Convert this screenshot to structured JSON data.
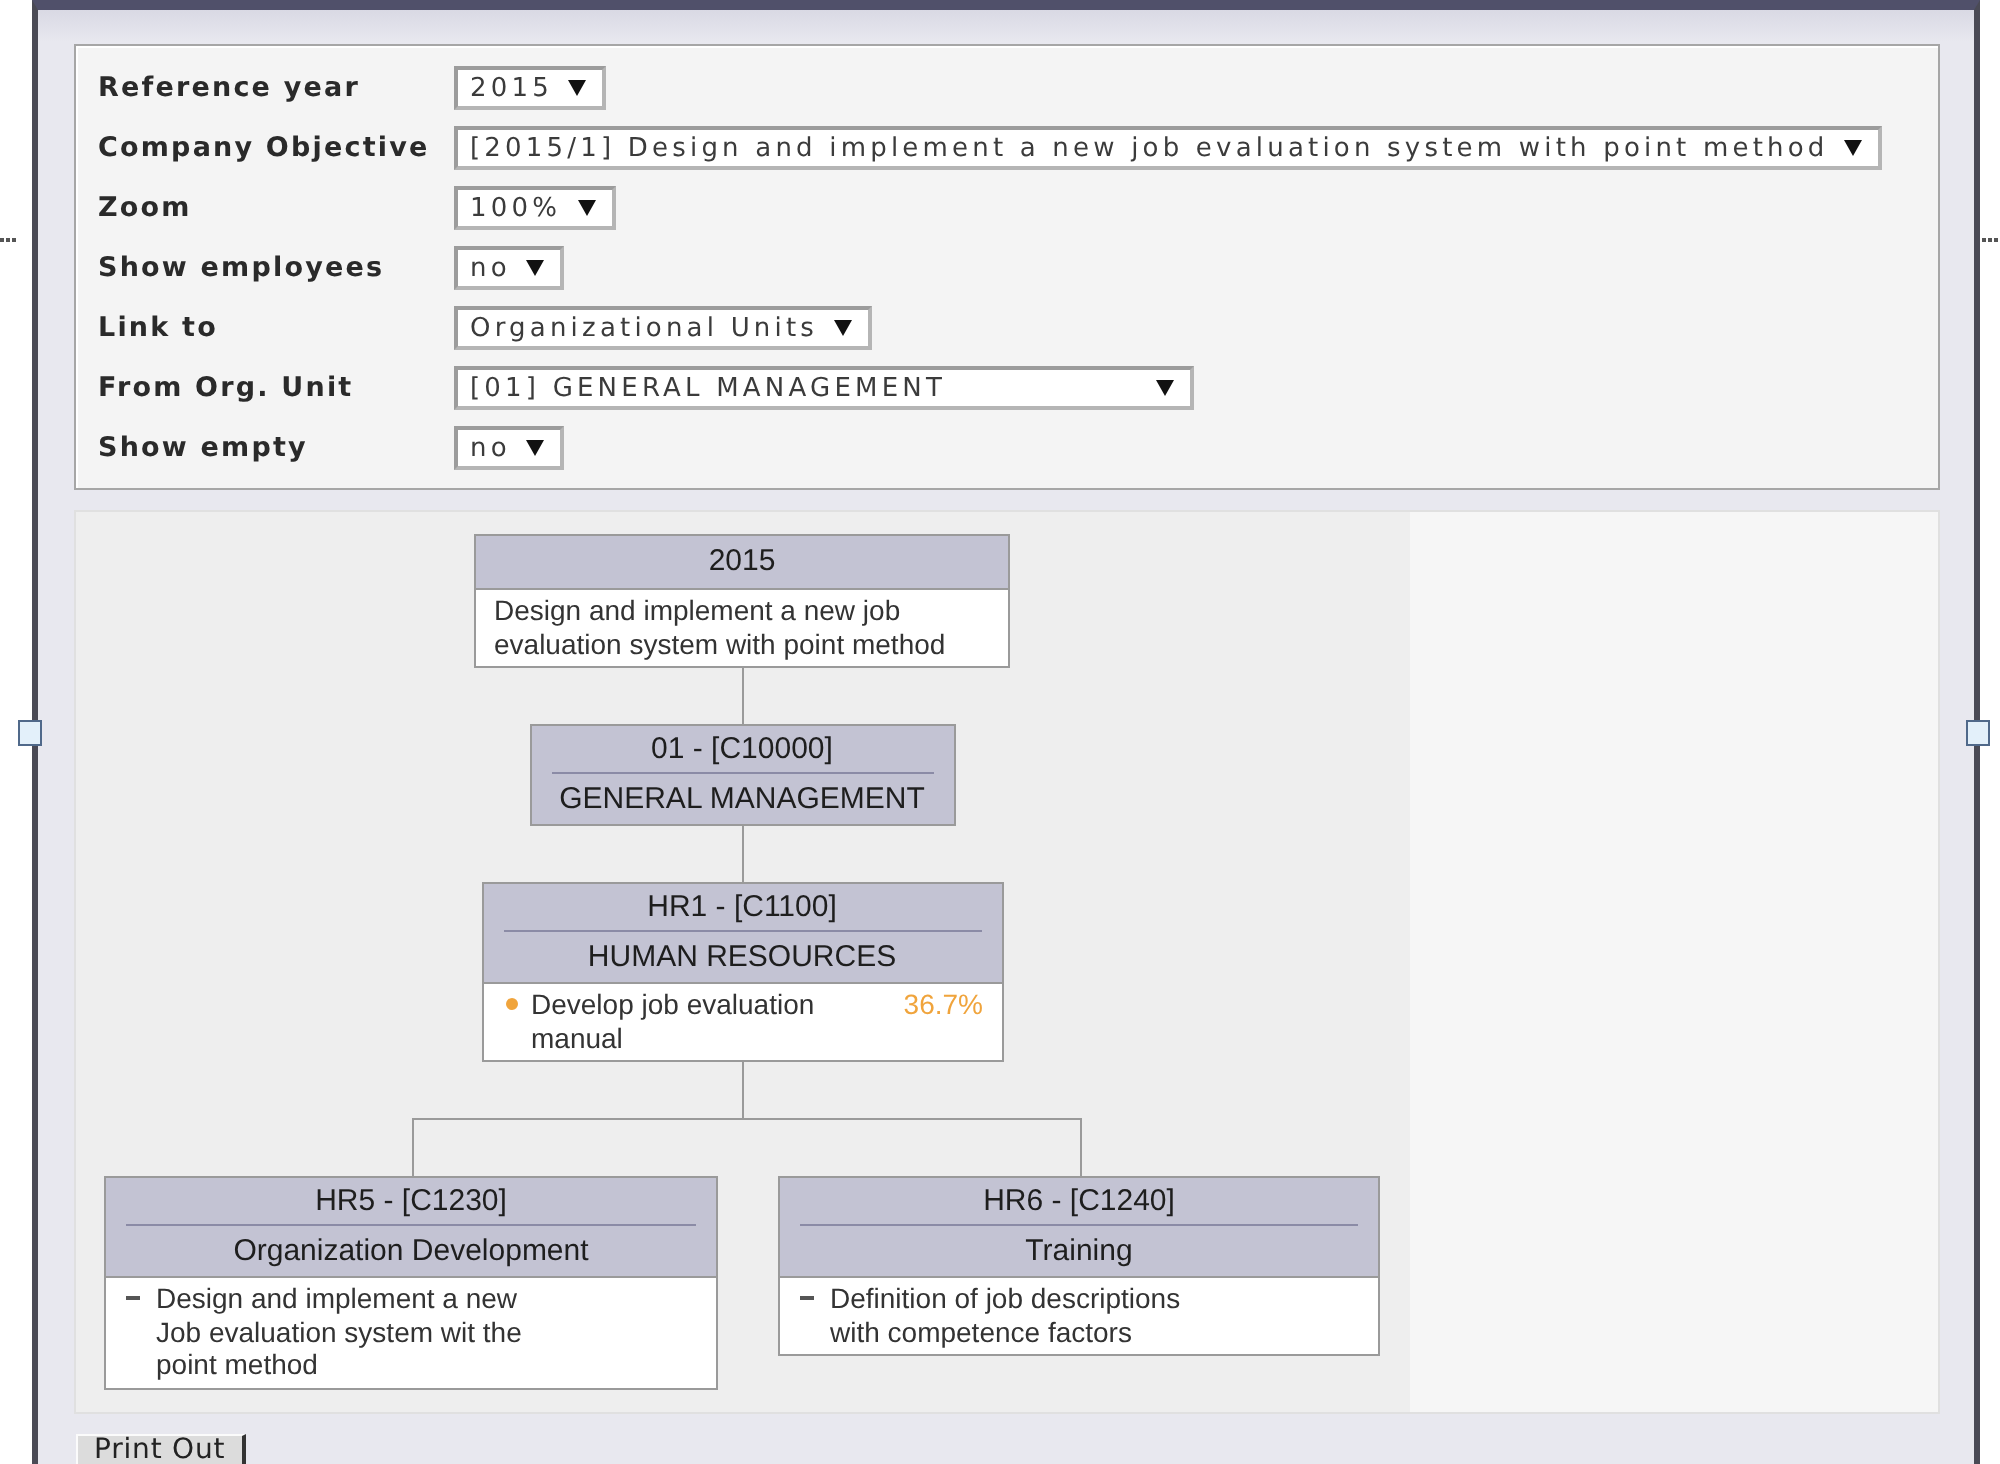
{
  "filters": [
    {
      "label": "Reference year",
      "value": "2015"
    },
    {
      "label": "Company Objective",
      "value": "[2015/1] Design and implement a new job evaluation system with point method"
    },
    {
      "label": "Zoom",
      "value": "100%"
    },
    {
      "label": "Show employees",
      "value": "no"
    },
    {
      "label": "Link to",
      "value": "Organizational Units"
    },
    {
      "label": "From Org. Unit",
      "value": "[01] GENERAL MANAGEMENT"
    },
    {
      "label": "Show empty",
      "value": "no"
    }
  ],
  "org_chart": {
    "root": {
      "kind": "objective",
      "title": "2015",
      "description": "Design and implement a new job evaluation system with point method",
      "children": [
        {
          "kind": "unit",
          "code": "01 - [C10000]",
          "name": "GENERAL MANAGEMENT",
          "children": [
            {
              "kind": "unit",
              "code": "HR1 - [C1100]",
              "name": "HUMAN RESOURCES",
              "objectives": [
                {
                  "kind": "dot",
                  "color": "#f0a43c",
                  "text": "Develop job evaluation manual",
                  "progress": "36.7%"
                }
              ],
              "children": [
                {
                  "kind": "unit",
                  "code": "HR5 - [C1230]",
                  "name": "Organization Development",
                  "objectives": [
                    {
                      "kind": "dash",
                      "text": "Design and implement a new Job evaluation system wit the point method"
                    }
                  ]
                },
                {
                  "kind": "unit",
                  "code": "HR6 - [C1240]",
                  "name": "Training",
                  "objectives": [
                    {
                      "kind": "dash",
                      "text": "Definition of job descriptions with competence factors"
                    }
                  ]
                }
              ]
            }
          ]
        }
      ]
    }
  },
  "print_button": {
    "label": "Print Out"
  }
}
